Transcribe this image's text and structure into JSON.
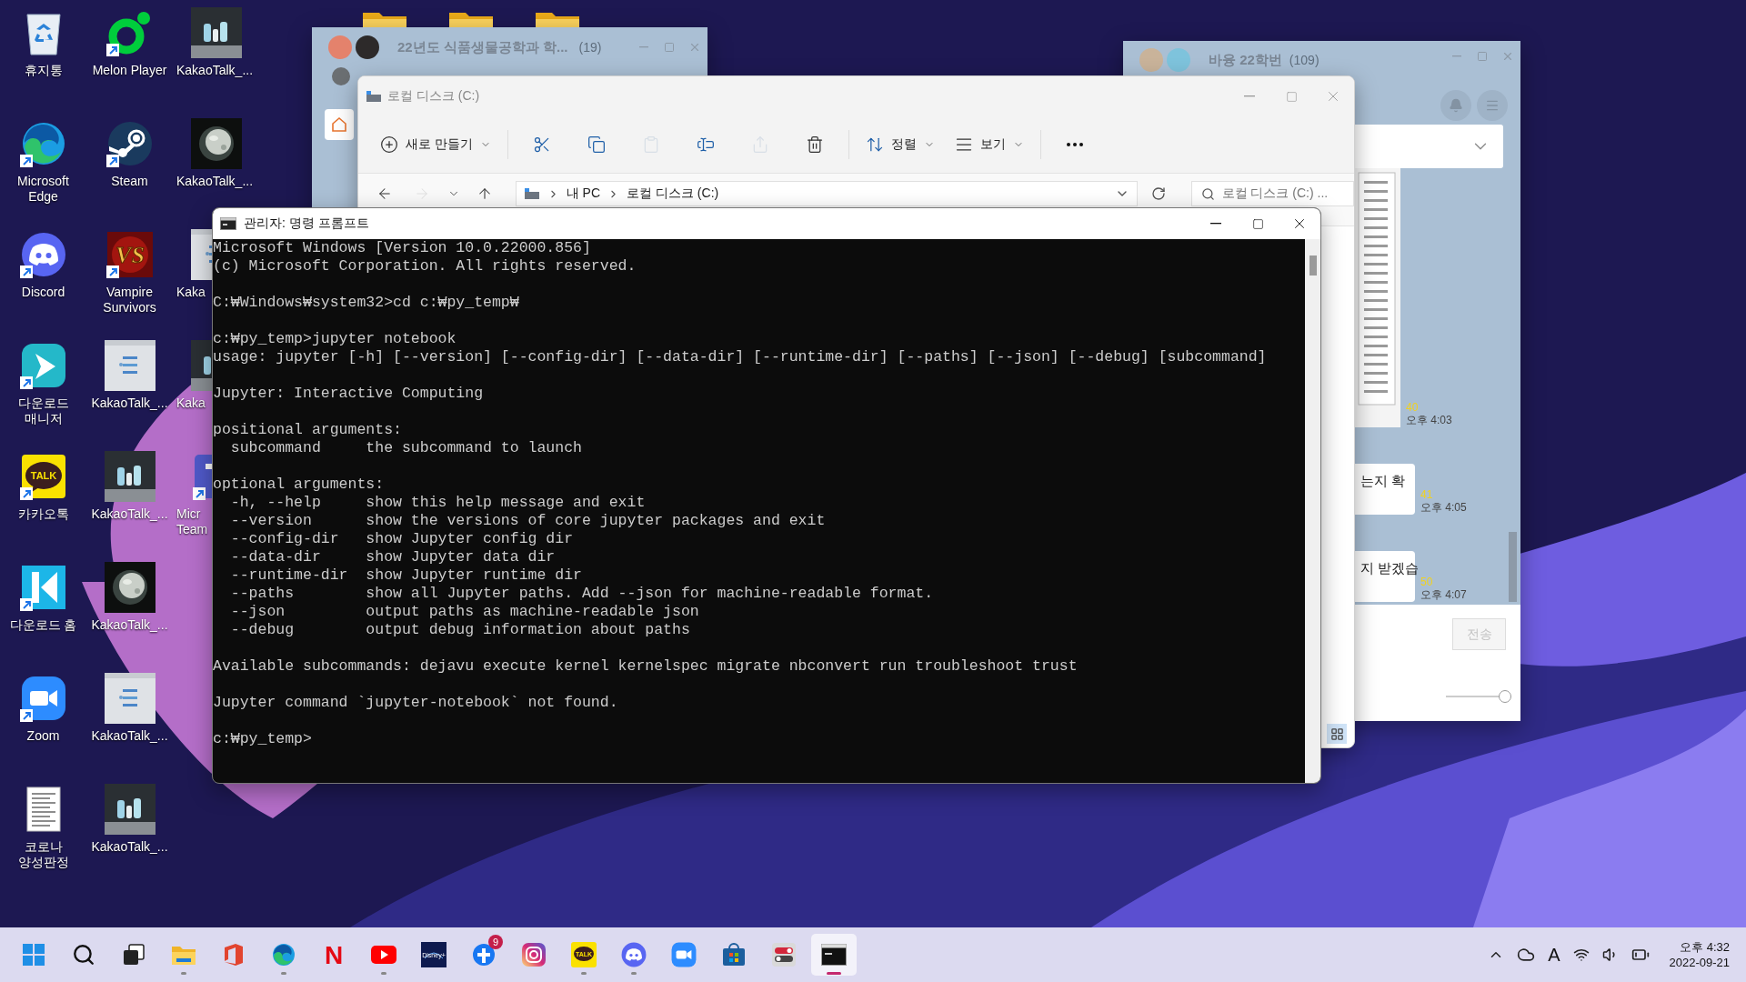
{
  "desktop_columns": [
    {
      "icons": [
        {
          "kind": "recycle_bin",
          "label_lines": [
            "휴지통"
          ],
          "shortcut": false
        },
        {
          "kind": "edge",
          "label_lines": [
            "Microsoft",
            "Edge"
          ],
          "shortcut": true
        },
        {
          "kind": "discord",
          "label_lines": [
            "Discord"
          ],
          "shortcut": true
        },
        {
          "kind": "download_manager",
          "label_lines": [
            "다운로드",
            "매니저"
          ],
          "shortcut": true
        },
        {
          "kind": "kakaotalk",
          "label_lines": [
            "카카오톡"
          ],
          "shortcut": true,
          "logo_text": "TALK"
        },
        {
          "kind": "download_home",
          "label_lines": [
            "다운로드 홈"
          ],
          "shortcut": true
        },
        {
          "kind": "zoom",
          "label_lines": [
            "Zoom"
          ],
          "shortcut": true
        },
        {
          "kind": "document",
          "label_lines": [
            "코로나",
            "양성판정"
          ],
          "shortcut": false
        }
      ]
    },
    {
      "icons": [
        {
          "kind": "melon",
          "label_lines": [
            "Melon Player"
          ],
          "shortcut": true
        },
        {
          "kind": "steam",
          "label_lines": [
            "Steam"
          ],
          "shortcut": true
        },
        {
          "kind": "vampire",
          "label_lines": [
            "Vampire",
            "Survivors"
          ],
          "shortcut": true,
          "logo_text": "VS"
        },
        {
          "kind": "picture",
          "label_lines": [
            "KakaoTalk_..."
          ],
          "shortcut": false
        },
        {
          "kind": "picture",
          "label_lines": [
            "KakaoTalk_..."
          ],
          "shortcut": false
        },
        {
          "kind": "picture",
          "label_lines": [
            "KakaoTalk_..."
          ],
          "shortcut": false
        },
        {
          "kind": "picture",
          "label_lines": [
            "KakaoTalk_..."
          ],
          "shortcut": false
        },
        {
          "kind": "picture",
          "label_lines": [
            "KakaoTalk_..."
          ],
          "shortcut": false
        }
      ]
    },
    {
      "icons": [
        {
          "kind": "picture",
          "label_lines": [
            "KakaoTalk_..."
          ],
          "shortcut": false
        },
        {
          "kind": "picture",
          "label_lines": [
            "KakaoTalk_..."
          ],
          "shortcut": false
        },
        {
          "kind": "picture",
          "label_lines": [
            "Kaka"
          ],
          "shortcut": false
        },
        {
          "kind": "picture",
          "label_lines": [
            "Kaka"
          ],
          "shortcut": false
        },
        {
          "kind": "teams",
          "label_lines": [
            "Micr",
            "Team"
          ],
          "shortcut": true
        }
      ]
    }
  ],
  "chat_left": {
    "title": "22년도 식품생물공학과 학...",
    "count": "(19)",
    "active": false
  },
  "chat_right": {
    "title": "바융 22학번",
    "count": "(109)",
    "active": false,
    "messages": [
      {
        "unread": "40",
        "time": "오후 4:03"
      },
      {
        "kind": "text",
        "text": "는지 확",
        "unread": "41",
        "time": "오후 4:05"
      },
      {
        "kind": "text",
        "text": "지 받겠습",
        "unread": "50",
        "time": "오후 4:07"
      }
    ],
    "send_button": {
      "label": "전송",
      "disabled": true
    },
    "opacity_slider": {
      "level": 1
    }
  },
  "explorer": {
    "title": "로컬 디스크 (C:)",
    "active": false,
    "toolbar": [
      {
        "kind": "new",
        "label": "새로 만들기",
        "disabled": false
      },
      {
        "kind": "cut",
        "disabled": false
      },
      {
        "kind": "copy",
        "disabled": false
      },
      {
        "kind": "paste",
        "disabled": true
      },
      {
        "kind": "rename",
        "disabled": false
      },
      {
        "kind": "share",
        "disabled": true
      },
      {
        "kind": "delete",
        "disabled": false
      },
      {
        "kind": "sort",
        "label": "정렬",
        "disabled": false
      },
      {
        "kind": "view",
        "label": "보기",
        "disabled": false
      },
      {
        "kind": "more",
        "disabled": false
      }
    ],
    "nav": [
      {
        "kind": "back",
        "disabled": false
      },
      {
        "kind": "forward",
        "disabled": true
      },
      {
        "kind": "recent",
        "disabled": false
      },
      {
        "kind": "up",
        "disabled": false
      }
    ],
    "breadcrumbs": [
      "내 PC",
      "로컬 디스크 (C:)"
    ],
    "search": {
      "placeholder": "로컬 디스크 (C:) ..."
    },
    "views": [
      {
        "kind": "tiles",
        "selected": true
      }
    ]
  },
  "cmd": {
    "title": "관리자: 명령 프롬프트",
    "active": true,
    "console_blocks": [
      [
        "Microsoft Windows [Version 10.0.22000.856]",
        "(c) Microsoft Corporation. All rights reserved."
      ],
      [
        "C:₩Windows₩system32>cd c:₩py_temp₩"
      ],
      [
        "c:₩py_temp>jupyter notebook",
        "usage: jupyter [-h] [--version] [--config-dir] [--data-dir] [--runtime-dir] [--paths] [--json] [--debug] [subcommand]"
      ],
      [
        "Jupyter: Interactive Computing"
      ],
      [
        "positional arguments:",
        "  subcommand     the subcommand to launch"
      ],
      [
        "optional arguments:",
        "  -h, --help     show this help message and exit",
        "  --version      show the versions of core jupyter packages and exit",
        "  --config-dir   show Jupyter config dir",
        "  --data-dir     show Jupyter data dir",
        "  --runtime-dir  show Jupyter runtime dir",
        "  --paths        show all Jupyter paths. Add --json for machine-readable format.",
        "  --json         output paths as machine-readable json",
        "  --debug        output debug information about paths"
      ],
      [
        "Available subcommands: dejavu execute kernel kernelspec migrate nbconvert run troubleshoot trust"
      ],
      [
        "Jupyter command `jupyter-notebook` not found."
      ],
      [
        "c:₩py_temp>"
      ]
    ]
  },
  "taskbar": {
    "apps": [
      {
        "kind": "start",
        "running": false,
        "active": false
      },
      {
        "kind": "search",
        "running": false,
        "active": false
      },
      {
        "kind": "task_view",
        "running": false,
        "active": false
      },
      {
        "kind": "file_explorer",
        "running": true,
        "active": false
      },
      {
        "kind": "office",
        "running": false,
        "active": false
      },
      {
        "kind": "edge",
        "running": true,
        "active": false
      },
      {
        "kind": "netflix",
        "running": false,
        "active": false,
        "logo_text": "N"
      },
      {
        "kind": "youtube",
        "running": true,
        "active": false
      },
      {
        "kind": "disney",
        "running": false,
        "active": false,
        "logo_text": "Disney+"
      },
      {
        "kind": "plus_app",
        "running": false,
        "active": false,
        "badge": "9"
      },
      {
        "kind": "instagram",
        "running": false,
        "active": false
      },
      {
        "kind": "kakaotalk",
        "running": true,
        "active": false,
        "logo_text": "TALK"
      },
      {
        "kind": "discord",
        "running": true,
        "active": false
      },
      {
        "kind": "zoom",
        "running": false,
        "active": false
      },
      {
        "kind": "store",
        "running": false,
        "active": false
      },
      {
        "kind": "toggle_app",
        "running": false,
        "active": false
      },
      {
        "kind": "terminal",
        "running": true,
        "active": true
      }
    ],
    "tray": {
      "ime": "A",
      "time": "오후 4:32",
      "date": "2022-09-21"
    }
  }
}
